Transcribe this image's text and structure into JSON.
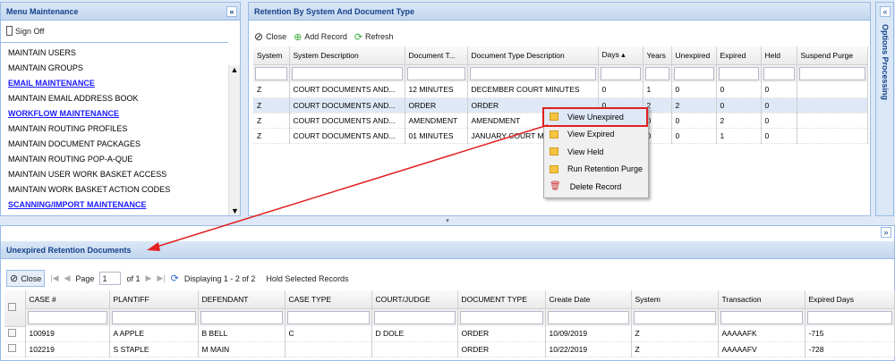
{
  "left_panel": {
    "title": "Menu Maintenance",
    "sign_off": "Sign Off",
    "items": [
      {
        "label": "MAINTAIN USERS",
        "link": false
      },
      {
        "label": "MAINTAIN GROUPS",
        "link": false
      },
      {
        "label": "EMAIL MAINTENANCE",
        "link": true
      },
      {
        "label": "MAINTAIN EMAIL ADDRESS BOOK",
        "link": false
      },
      {
        "label": "WORKFLOW MAINTENANCE",
        "link": true
      },
      {
        "label": "MAINTAIN ROUTING PROFILES",
        "link": false
      },
      {
        "label": "MAINTAIN DOCUMENT PACKAGES",
        "link": false
      },
      {
        "label": "MAINTAIN ROUTING POP-A-QUE",
        "link": false
      },
      {
        "label": "MAINTAIN USER WORK BASKET ACCESS",
        "link": false
      },
      {
        "label": "MAINTAIN WORK BASKET ACTION CODES",
        "link": false
      },
      {
        "label": "SCANNING/IMPORT MAINTENANCE",
        "link": true
      }
    ]
  },
  "retention": {
    "title": "Retention By System And Document Type",
    "toolbar": {
      "close": "Close",
      "add": "Add Record",
      "refresh": "Refresh"
    },
    "columns": [
      "System",
      "System Description",
      "Document T...",
      "Document Type Description",
      "Days ▴",
      "Years",
      "Unexpired",
      "Expired",
      "Held",
      "Suspend Purge"
    ],
    "rows": [
      [
        "Z",
        "COURT DOCUMENTS AND...",
        "12 MINUTES",
        "DECEMBER COURT MINUTES",
        "0",
        "1",
        "0",
        "0",
        "0",
        ""
      ],
      [
        "Z",
        "COURT DOCUMENTS AND...",
        "ORDER",
        "ORDER",
        "0",
        "2",
        "2",
        "0",
        "0",
        ""
      ],
      [
        "Z",
        "COURT DOCUMENTS AND...",
        "AMENDMENT",
        "AMENDMENT",
        "0",
        "0",
        "0",
        "2",
        "0",
        ""
      ],
      [
        "Z",
        "COURT DOCUMENTS AND...",
        "01 MINUTES",
        "JANUARY COURT MINUTES",
        "0",
        "0",
        "0",
        "1",
        "0",
        ""
      ]
    ]
  },
  "options_panel": {
    "title": "Options Processing"
  },
  "context_menu": [
    "View Unexpired",
    "View Expired",
    "View Held",
    "Run Retention Purge",
    "Delete Record"
  ],
  "unexpired": {
    "title": "Unexpired Retention Documents",
    "toolbar": {
      "close": "Close",
      "page_label": "Page",
      "page": "1",
      "of": "of 1",
      "displaying": "Displaying 1 - 2 of 2",
      "hold": "Hold Selected Records"
    },
    "columns": [
      "CASE #",
      "PLANTIFF",
      "DEFENDANT",
      "CASE TYPE",
      "COURT/JUDGE",
      "DOCUMENT TYPE",
      "Create Date",
      "System",
      "Transaction",
      "Expired Days"
    ],
    "rows": [
      [
        "100919",
        "A APPLE",
        "B BELL",
        "C",
        "D DOLE",
        "ORDER",
        "10/09/2019",
        "Z",
        "AAAAAFK",
        "-715"
      ],
      [
        "102219",
        "S STAPLE",
        "M MAIN",
        "",
        "",
        "ORDER",
        "10/22/2019",
        "Z",
        "AAAAAFV",
        "-728"
      ]
    ]
  },
  "colors": {
    "accent": "#15428b",
    "highlight": "#e02020"
  }
}
